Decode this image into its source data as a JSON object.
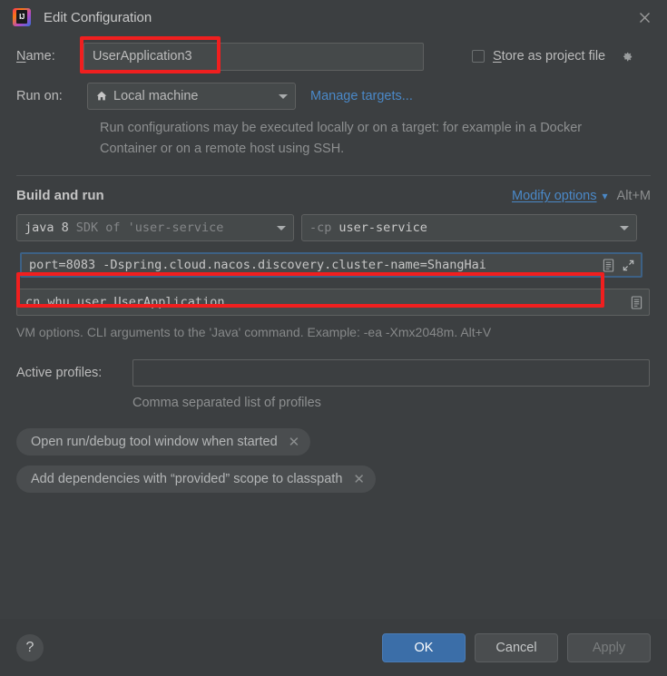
{
  "window": {
    "title": "Edit Configuration",
    "logo_text": "IJ",
    "close_icon": "close-icon"
  },
  "form": {
    "name_label": "Name:",
    "name_label_mnemonic": "N",
    "name_value": "UserApplication3",
    "store_as_project_file_label": "Store as project file",
    "store_as_project_file_mnemonic": "S",
    "store_as_project_file_checked": false,
    "gear_icon": "gear-icon",
    "run_on_label": "Run on:",
    "run_on_value": "Local machine",
    "run_on_icon": "home-icon",
    "manage_targets_link": "Manage targets...",
    "run_on_help": "Run configurations may be executed locally or on a target: for example in a Docker Container or on a remote host using SSH."
  },
  "build_and_run": {
    "section_title": "Build and run",
    "modify_options_link": "Modify options",
    "modify_options_mnemonic": "M",
    "modify_options_shortcut": "Alt+M",
    "jdk_prefix": "java 8",
    "jdk_suffix": "SDK of 'user-service",
    "classpath_prefix": "-cp",
    "classpath_value": "user-service",
    "vm_options_value": "port=8083 -Dspring.cloud.nacos.discovery.cluster-name=ShangHai",
    "vm_options_list_icon": "document-list-icon",
    "vm_options_expand_icon": "expand-icon",
    "main_class_value": "cn.whu.user.UserApplication",
    "main_class_icon": "document-list-icon",
    "vm_options_hint": "VM options. CLI arguments to the 'Java' command. Example: -ea -Xmx2048m. Alt+V"
  },
  "profiles": {
    "active_profiles_label": "Active profiles:",
    "active_profiles_value": "",
    "active_profiles_hint": "Comma separated list of profiles"
  },
  "chips": [
    {
      "label": "Open run/debug tool window when started",
      "remove_icon": "close-icon"
    },
    {
      "label": "Add dependencies with “provided” scope to classpath",
      "remove_icon": "close-icon"
    }
  ],
  "footer": {
    "help_label": "?",
    "ok_label": "OK",
    "cancel_label": "Cancel",
    "apply_label": "Apply",
    "apply_enabled": false
  },
  "annotations": {
    "color": "#f01f1f",
    "boxes": [
      "name-field-highlight",
      "vm-options-field-highlight"
    ]
  },
  "colors": {
    "background": "#3c3f41",
    "field_background": "#45494a",
    "accent_blue": "#4a88c7",
    "primary_button": "#3b6ea8",
    "annotation_red": "#f01f1f",
    "focus_border": "#3d6185"
  }
}
